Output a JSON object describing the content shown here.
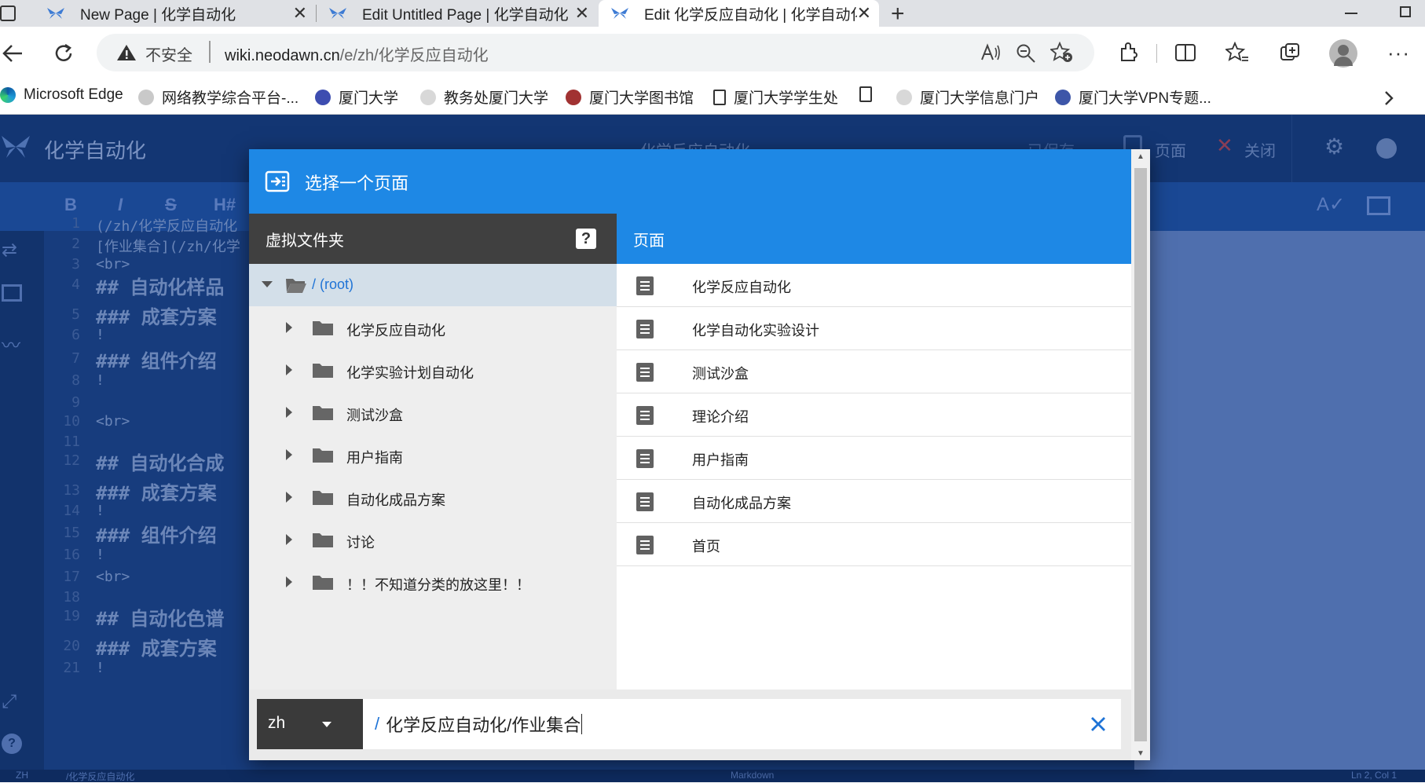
{
  "browser": {
    "tabs": [
      {
        "title": "New Page | 化学自动化",
        "active": false
      },
      {
        "title": "Edit Untitled Page | 化学自动化",
        "active": false
      },
      {
        "title": "Edit 化学反应自动化 | 化学自动化",
        "active": true
      }
    ],
    "new_tab_label": "+",
    "security_label": "不安全",
    "url_host": "wiki.neodawn.cn",
    "url_path": "/e/zh/化学反应自动化",
    "bookmarks": [
      {
        "label": "Microsoft Edge",
        "color": "#1e9bd8"
      },
      {
        "label": "网络教学综合平台-...",
        "color": "#c9c9c9"
      },
      {
        "label": "厦门大学",
        "color": "#3d4db0"
      },
      {
        "label": "教务处厦门大学",
        "color": "#d8d8d8"
      },
      {
        "label": "厦门大学图书馆",
        "color": "#a13232"
      },
      {
        "label": "厦门大学学生处",
        "color": "#ffffff"
      },
      {
        "label": "",
        "color": "#ffffff"
      },
      {
        "label": "厦门大学信息门户",
        "color": "#d8d8d8"
      },
      {
        "label": "厦门大学VPN专题...",
        "color": "#3d56a8"
      }
    ]
  },
  "app": {
    "site_title": "化学自动化",
    "center_title": "化学反应自动化",
    "saved_label": "已保存",
    "page_btn": "页面",
    "close_btn": "关闭",
    "toolbar": [
      "B",
      "I",
      "S",
      "H#"
    ],
    "editor_lines": [
      {
        "n": "1",
        "text": "(/zh/化学反应自动化"
      },
      {
        "n": "2",
        "text": "[作业集合](/zh/化学"
      },
      {
        "n": "3",
        "text": "<br>"
      },
      {
        "n": "4",
        "text": "## 自动化样品"
      },
      {
        "n": "5",
        "text": "### 成套方案"
      },
      {
        "n": "6",
        "text": "!"
      },
      {
        "n": "7",
        "text": "### 组件介绍"
      },
      {
        "n": "8",
        "text": "!"
      },
      {
        "n": "9",
        "text": ""
      },
      {
        "n": "10",
        "text": "<br>"
      },
      {
        "n": "11",
        "text": ""
      },
      {
        "n": "12",
        "text": "## 自动化合成"
      },
      {
        "n": "13",
        "text": "### 成套方案"
      },
      {
        "n": "14",
        "text": "!"
      },
      {
        "n": "15",
        "text": "### 组件介绍"
      },
      {
        "n": "16",
        "text": "!"
      },
      {
        "n": "17",
        "text": "<br>"
      },
      {
        "n": "18",
        "text": ""
      },
      {
        "n": "19",
        "text": "## 自动化色谱"
      },
      {
        "n": "20",
        "text": "### 成套方案"
      },
      {
        "n": "21",
        "text": "!"
      }
    ],
    "status_left": "ZH",
    "status_path": "/化学反应自动化",
    "status_mode": "Markdown",
    "status_pos": "Ln 2, Col 1"
  },
  "dialog": {
    "title": "选择一个页面",
    "left_header": "虚拟文件夹",
    "help_label": "?",
    "root_label": "/ (root)",
    "folders": [
      "化学反应自动化",
      "化学实验计划自动化",
      "测试沙盒",
      "用户指南",
      "自动化成品方案",
      "讨论",
      "！！不知道分类的放这里！！"
    ],
    "right_header": "页面",
    "pages": [
      "化学反应自动化",
      "化学自动化实验设计",
      "测试沙盒",
      "理论介绍",
      "用户指南",
      "自动化成品方案",
      "首页"
    ],
    "locale": "zh",
    "path_prefix": "/",
    "path_value": "化学反应自动化/作业集合"
  },
  "colors": {
    "accent": "#1e88e5",
    "dark_header": "#404040",
    "selected_row": "#d3dfe9"
  }
}
